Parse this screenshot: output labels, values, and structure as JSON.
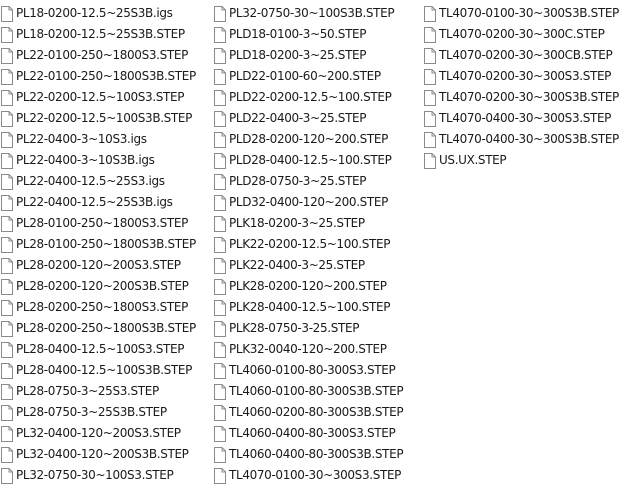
{
  "columns": [
    {
      "files": [
        "PL18-0200-12.5~25S3B.igs",
        "PL18-0200-12.5~25S3B.STEP",
        "PL22-0100-250~1800S3.STEP",
        "PL22-0100-250~1800S3B.STEP",
        "PL22-0200-12.5~100S3.STEP",
        "PL22-0200-12.5~100S3B.STEP",
        "PL22-0400-3~10S3.igs",
        "PL22-0400-3~10S3B.igs",
        "PL22-0400-12.5~25S3.igs",
        "PL22-0400-12.5~25S3B.igs",
        "PL28-0100-250~1800S3.STEP",
        "PL28-0100-250~1800S3B.STEP",
        "PL28-0200-120~200S3.STEP",
        "PL28-0200-120~200S3B.STEP",
        "PL28-0200-250~1800S3.STEP",
        "PL28-0200-250~1800S3B.STEP",
        "PL28-0400-12.5~100S3.STEP",
        "PL28-0400-12.5~100S3B.STEP",
        "PL28-0750-3~25S3.STEP",
        "PL28-0750-3~25S3B.STEP",
        "PL32-0400-120~200S3.STEP",
        "PL32-0400-120~200S3B.STEP",
        "PL32-0750-30~100S3.STEP"
      ]
    },
    {
      "files": [
        "PL32-0750-30~100S3B.STEP",
        "PLD18-0100-3~50.STEP",
        "PLD18-0200-3~25.STEP",
        "PLD22-0100-60~200.STEP",
        "PLD22-0200-12.5~100.STEP",
        "PLD22-0400-3~25.STEP",
        "PLD28-0200-120~200.STEP",
        "PLD28-0400-12.5~100.STEP",
        "PLD28-0750-3~25.STEP",
        "PLD32-0400-120~200.STEP",
        "PLK18-0200-3~25.STEP",
        "PLK22-0200-12.5~100.STEP",
        "PLK22-0400-3~25.STEP",
        "PLK28-0200-120~200.STEP",
        "PLK28-0400-12.5~100.STEP",
        "PLK28-0750-3-25.STEP",
        "PLK32-0040-120~200.STEP",
        "TL4060-0100-80-300S3.STEP",
        "TL4060-0100-80-300S3B.STEP",
        "TL4060-0200-80-300S3B.STEP",
        "TL4060-0400-80-300S3.STEP",
        "TL4060-0400-80-300S3B.STEP",
        "TL4070-0100-30~300S3.STEP"
      ]
    },
    {
      "files": [
        "TL4070-0100-30~300S3B.STEP",
        "TL4070-0200-30~300C.STEP",
        "TL4070-0200-30~300CB.STEP",
        "TL4070-0200-30~300S3.STEP",
        "TL4070-0200-30~300S3B.STEP",
        "TL4070-0400-30~300S3.STEP",
        "TL4070-0400-30~300S3B.STEP",
        "US.UX.STEP"
      ]
    }
  ],
  "icon": "generic-file-icon",
  "colors": {
    "background": "#ffffff",
    "text": "#1a1a1a",
    "icon_outline": "#8a8a8a",
    "icon_fill": "#ffffff"
  }
}
